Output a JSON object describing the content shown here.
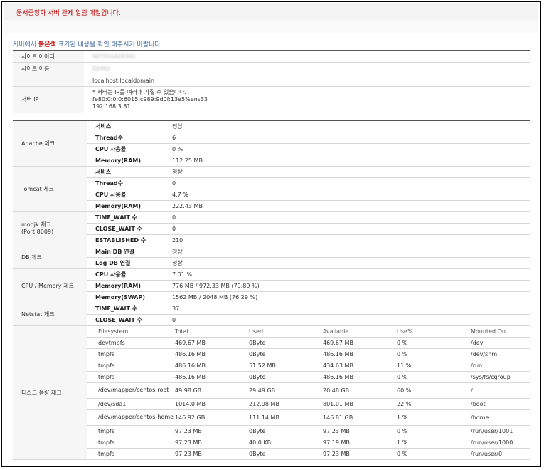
{
  "header": {
    "title": "문서중앙화 서버 관제 알림 메일입니다."
  },
  "notice": {
    "prefix": "서버에서 ",
    "highlight": "붉은색",
    "suffix": " 표기된 내용을 확인 해주시기 바랍니다."
  },
  "site": {
    "id_label": "사이트 아이디",
    "id_value": "NETIDGADEMO",
    "name_label": "사이트 이름",
    "name_value": "DEMO",
    "hostname": "localhost.localdomain",
    "ip_label": "서버 IP",
    "ip_lines": [
      "* 서버는 IP를 여러개 가질 수 있습니다.",
      "fe80:0:0:0:6015:c989:9d0f:13e5%ens33",
      "192.168.3.81"
    ]
  },
  "apache": {
    "label": "Apache 체크",
    "rows": [
      {
        "key": "서비스",
        "value": "정상"
      },
      {
        "key": "Thread수",
        "value": "6"
      },
      {
        "key": "CPU 사용률",
        "value": "0 %"
      },
      {
        "key": "Memory(RAM)",
        "value": "112.25 MB"
      }
    ]
  },
  "tomcat": {
    "label": "Tomcat 체크",
    "rows": [
      {
        "key": "서비스",
        "value": "정상"
      },
      {
        "key": "Thread수",
        "value": "0"
      },
      {
        "key": "CPU 사용률",
        "value": "4.7 %"
      },
      {
        "key": "Memory(RAM)",
        "value": "222.43 MB"
      }
    ]
  },
  "modjk": {
    "label": "modjk 체크",
    "label2": "(Port:8009)",
    "rows": [
      {
        "key": "TIME_WAIT 수",
        "value": "0"
      },
      {
        "key": "CLOSE_WAIT 수",
        "value": "0"
      },
      {
        "key": "ESTABLISHED 수",
        "value": "210"
      }
    ]
  },
  "db": {
    "label": "DB 체크",
    "rows": [
      {
        "key": "Main DB 연결",
        "value": "정상"
      },
      {
        "key": "Log DB 연결",
        "value": "정상"
      }
    ]
  },
  "cpumem": {
    "label": "CPU / Memory 체크",
    "rows": [
      {
        "key": "CPU 사용률",
        "value": "7.01 %"
      },
      {
        "key": "Memory(RAM)",
        "value": "776 MB / 972.33 MB (79.89 %)"
      },
      {
        "key": "Memory(SWAP)",
        "value": "1562 MB / 2048 MB (76.29 %)"
      }
    ]
  },
  "netstat": {
    "label": "Netstat 체크",
    "rows": [
      {
        "key": "TIME_WAIT 수",
        "value": "37"
      },
      {
        "key": "CLOSE_WAIT 수",
        "value": "0"
      }
    ]
  },
  "disk": {
    "label": "디스크 용량 체크",
    "headers": [
      "Filesystem",
      "Total",
      "Used",
      "Available",
      "Use%",
      "Mounted On"
    ],
    "rows": [
      [
        "devtmpfs",
        "469.67 MB",
        "0Byte",
        "469.67 MB",
        "0 %",
        "/dev"
      ],
      [
        "tmpfs",
        "486.16 MB",
        "0Byte",
        "486.16 MB",
        "0 %",
        "/dev/shm"
      ],
      [
        "tmpfs",
        "486.16 MB",
        "51.52 MB",
        "434.63 MB",
        "11 %",
        "/run"
      ],
      [
        "tmpfs",
        "486.16 MB",
        "0Byte",
        "486.16 MB",
        "0 %",
        "/sys/fs/cgroup"
      ],
      [
        "/dev/mapper/centos-root",
        "49.98 GB",
        "29.49 GB",
        "20.48 GB",
        "60 %",
        "/"
      ],
      [
        "/dev/sda1",
        "1014.0 MB",
        "212.98 MB",
        "801.01 MB",
        "22 %",
        "/boot"
      ],
      [
        "/dev/mapper/centos-home",
        "146.92 GB",
        "111.14 MB",
        "146.81 GB",
        "1 %",
        "/home"
      ],
      [
        "tmpfs",
        "97.23 MB",
        "0Byte",
        "97.23 MB",
        "0 %",
        "/run/user/1001"
      ],
      [
        "tmpfs",
        "97.23 MB",
        "40.0 KB",
        "97.19 MB",
        "1 %",
        "/run/user/1000"
      ],
      [
        "tmpfs",
        "97.23 MB",
        "0Byte",
        "97.23 MB",
        "0 %",
        "/run/user/0"
      ]
    ]
  }
}
